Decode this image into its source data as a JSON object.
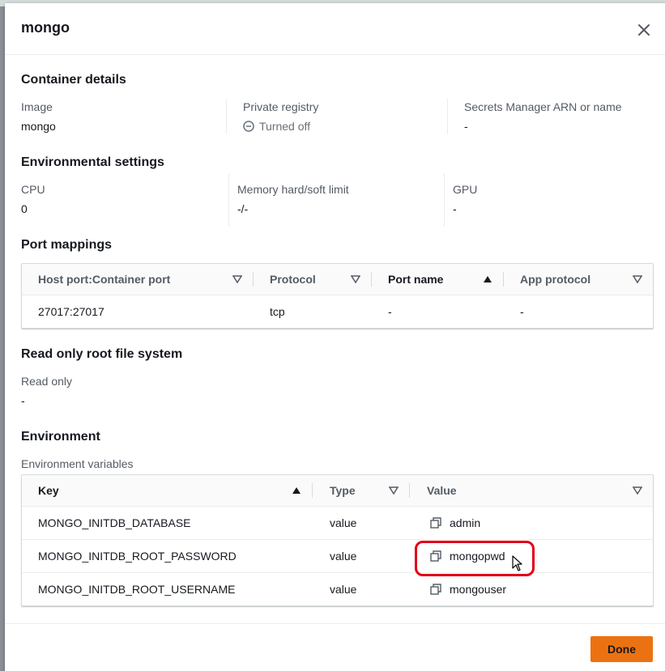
{
  "modal": {
    "title": "mongo",
    "done_label": "Done"
  },
  "container_details": {
    "title": "Container details",
    "image_label": "Image",
    "image_value": "mongo",
    "registry_label": "Private registry",
    "registry_value": "Turned off",
    "secrets_label": "Secrets Manager ARN or name",
    "secrets_value": "-"
  },
  "environmental_settings": {
    "title": "Environmental settings",
    "cpu_label": "CPU",
    "cpu_value": "0",
    "memory_label": "Memory hard/soft limit",
    "memory_value": "-/-",
    "gpu_label": "GPU",
    "gpu_value": "-"
  },
  "port_mappings": {
    "title": "Port mappings",
    "columns": [
      "Host port:Container port",
      "Protocol",
      "Port name",
      "App protocol"
    ],
    "rows": [
      [
        "27017:27017",
        "tcp",
        "-",
        "-"
      ]
    ]
  },
  "read_only": {
    "title": "Read only root file system",
    "label": "Read only",
    "value": "-"
  },
  "environment": {
    "title": "Environment",
    "subtitle": "Environment variables",
    "columns": [
      "Key",
      "Type",
      "Value"
    ],
    "rows": [
      {
        "key": "MONGO_INITDB_DATABASE",
        "type": "value",
        "value": "admin"
      },
      {
        "key": "MONGO_INITDB_ROOT_PASSWORD",
        "type": "value",
        "value": "mongopwd"
      },
      {
        "key": "MONGO_INITDB_ROOT_USERNAME",
        "type": "value",
        "value": "mongouser"
      }
    ]
  },
  "colors": {
    "primary_button": "#ec7211",
    "highlight": "#e00016",
    "label_text": "#545b64"
  },
  "icons": [
    "close-icon",
    "status-off-icon",
    "sort-filter-icon",
    "sort-ascending-icon",
    "copy-icon",
    "mouse-cursor-icon"
  ]
}
